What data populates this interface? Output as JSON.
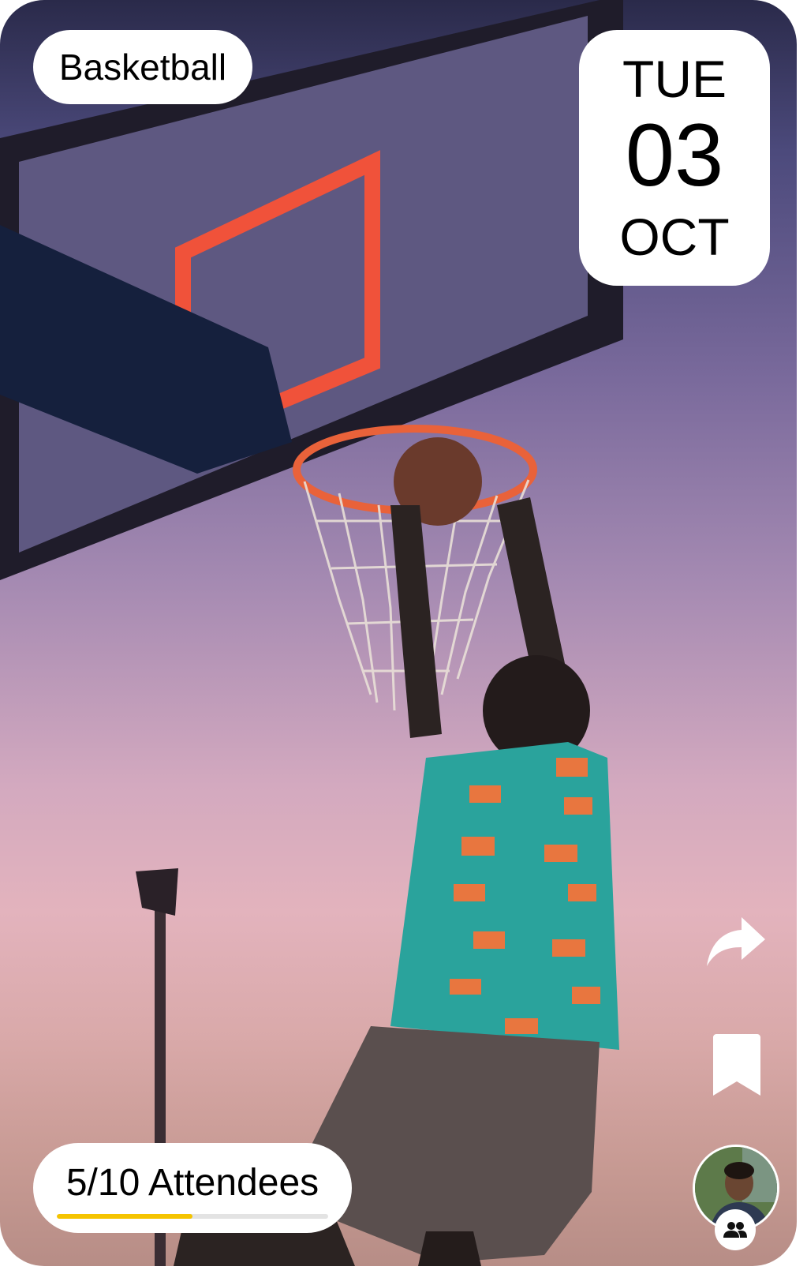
{
  "event": {
    "sport_label": "Basketball",
    "date": {
      "weekday": "TUE",
      "day": "03",
      "month": "OCT"
    },
    "attendees": {
      "label": "5/10 Attendees",
      "current": 5,
      "capacity": 10
    }
  },
  "actions": [
    {
      "name": "share",
      "icon": "share-arrow-icon"
    },
    {
      "name": "bookmark",
      "icon": "bookmark-icon"
    }
  ],
  "organizer": {
    "avatar_icon": "avatar",
    "badge_icon": "group-icon"
  },
  "colors": {
    "progress_fill": "#f5c400",
    "progress_track": "#e3e3e3",
    "pill_background": "#ffffff"
  }
}
